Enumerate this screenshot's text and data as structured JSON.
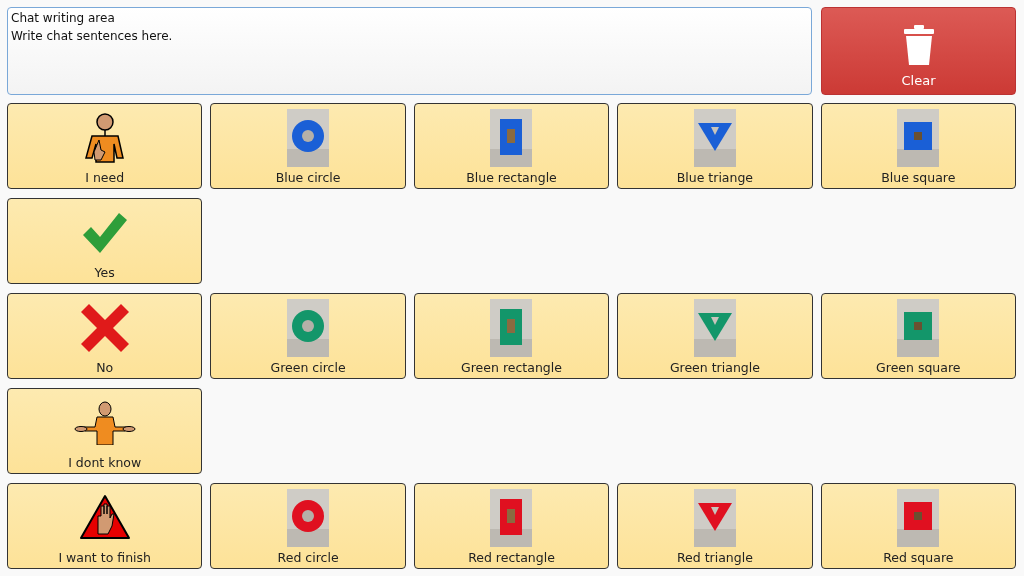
{
  "chat_area": {
    "lines": [
      "Chat writing area",
      "Write chat sentences here."
    ]
  },
  "clear_button": {
    "label": "Clear"
  },
  "rows": [
    {
      "cells": [
        {
          "kind": "person-need",
          "label": "I need"
        },
        {
          "kind": "picture",
          "color": "#1a5fd6",
          "label": "Blue circle"
        },
        {
          "kind": "picture",
          "color": "#1a5fd6",
          "label": "Blue rectangle"
        },
        {
          "kind": "picture",
          "color": "#1a5fd6",
          "label": "Blue triange"
        },
        {
          "kind": "picture",
          "color": "#1a5fd6",
          "label": "Blue square"
        }
      ]
    },
    {
      "cells": [
        {
          "kind": "check",
          "label": "Yes"
        }
      ]
    },
    {
      "cells": [
        {
          "kind": "cross",
          "label": "No"
        },
        {
          "kind": "picture",
          "color": "#13966a",
          "label": "Green circle"
        },
        {
          "kind": "picture",
          "color": "#13966a",
          "label": "Green rectangle"
        },
        {
          "kind": "picture",
          "color": "#13966a",
          "label": "Green triangle"
        },
        {
          "kind": "picture",
          "color": "#13966a",
          "label": "Green square"
        }
      ]
    },
    {
      "cells": [
        {
          "kind": "shrug",
          "label": "I dont know"
        }
      ]
    },
    {
      "cells": [
        {
          "kind": "stop",
          "label": "I want to finish"
        },
        {
          "kind": "picture",
          "color": "#e01020",
          "label": "Red circle"
        },
        {
          "kind": "picture",
          "color": "#e01020",
          "label": "Red rectangle"
        },
        {
          "kind": "picture",
          "color": "#e01020",
          "label": "Red triangle"
        },
        {
          "kind": "picture",
          "color": "#e01020",
          "label": "Red square"
        }
      ]
    }
  ]
}
